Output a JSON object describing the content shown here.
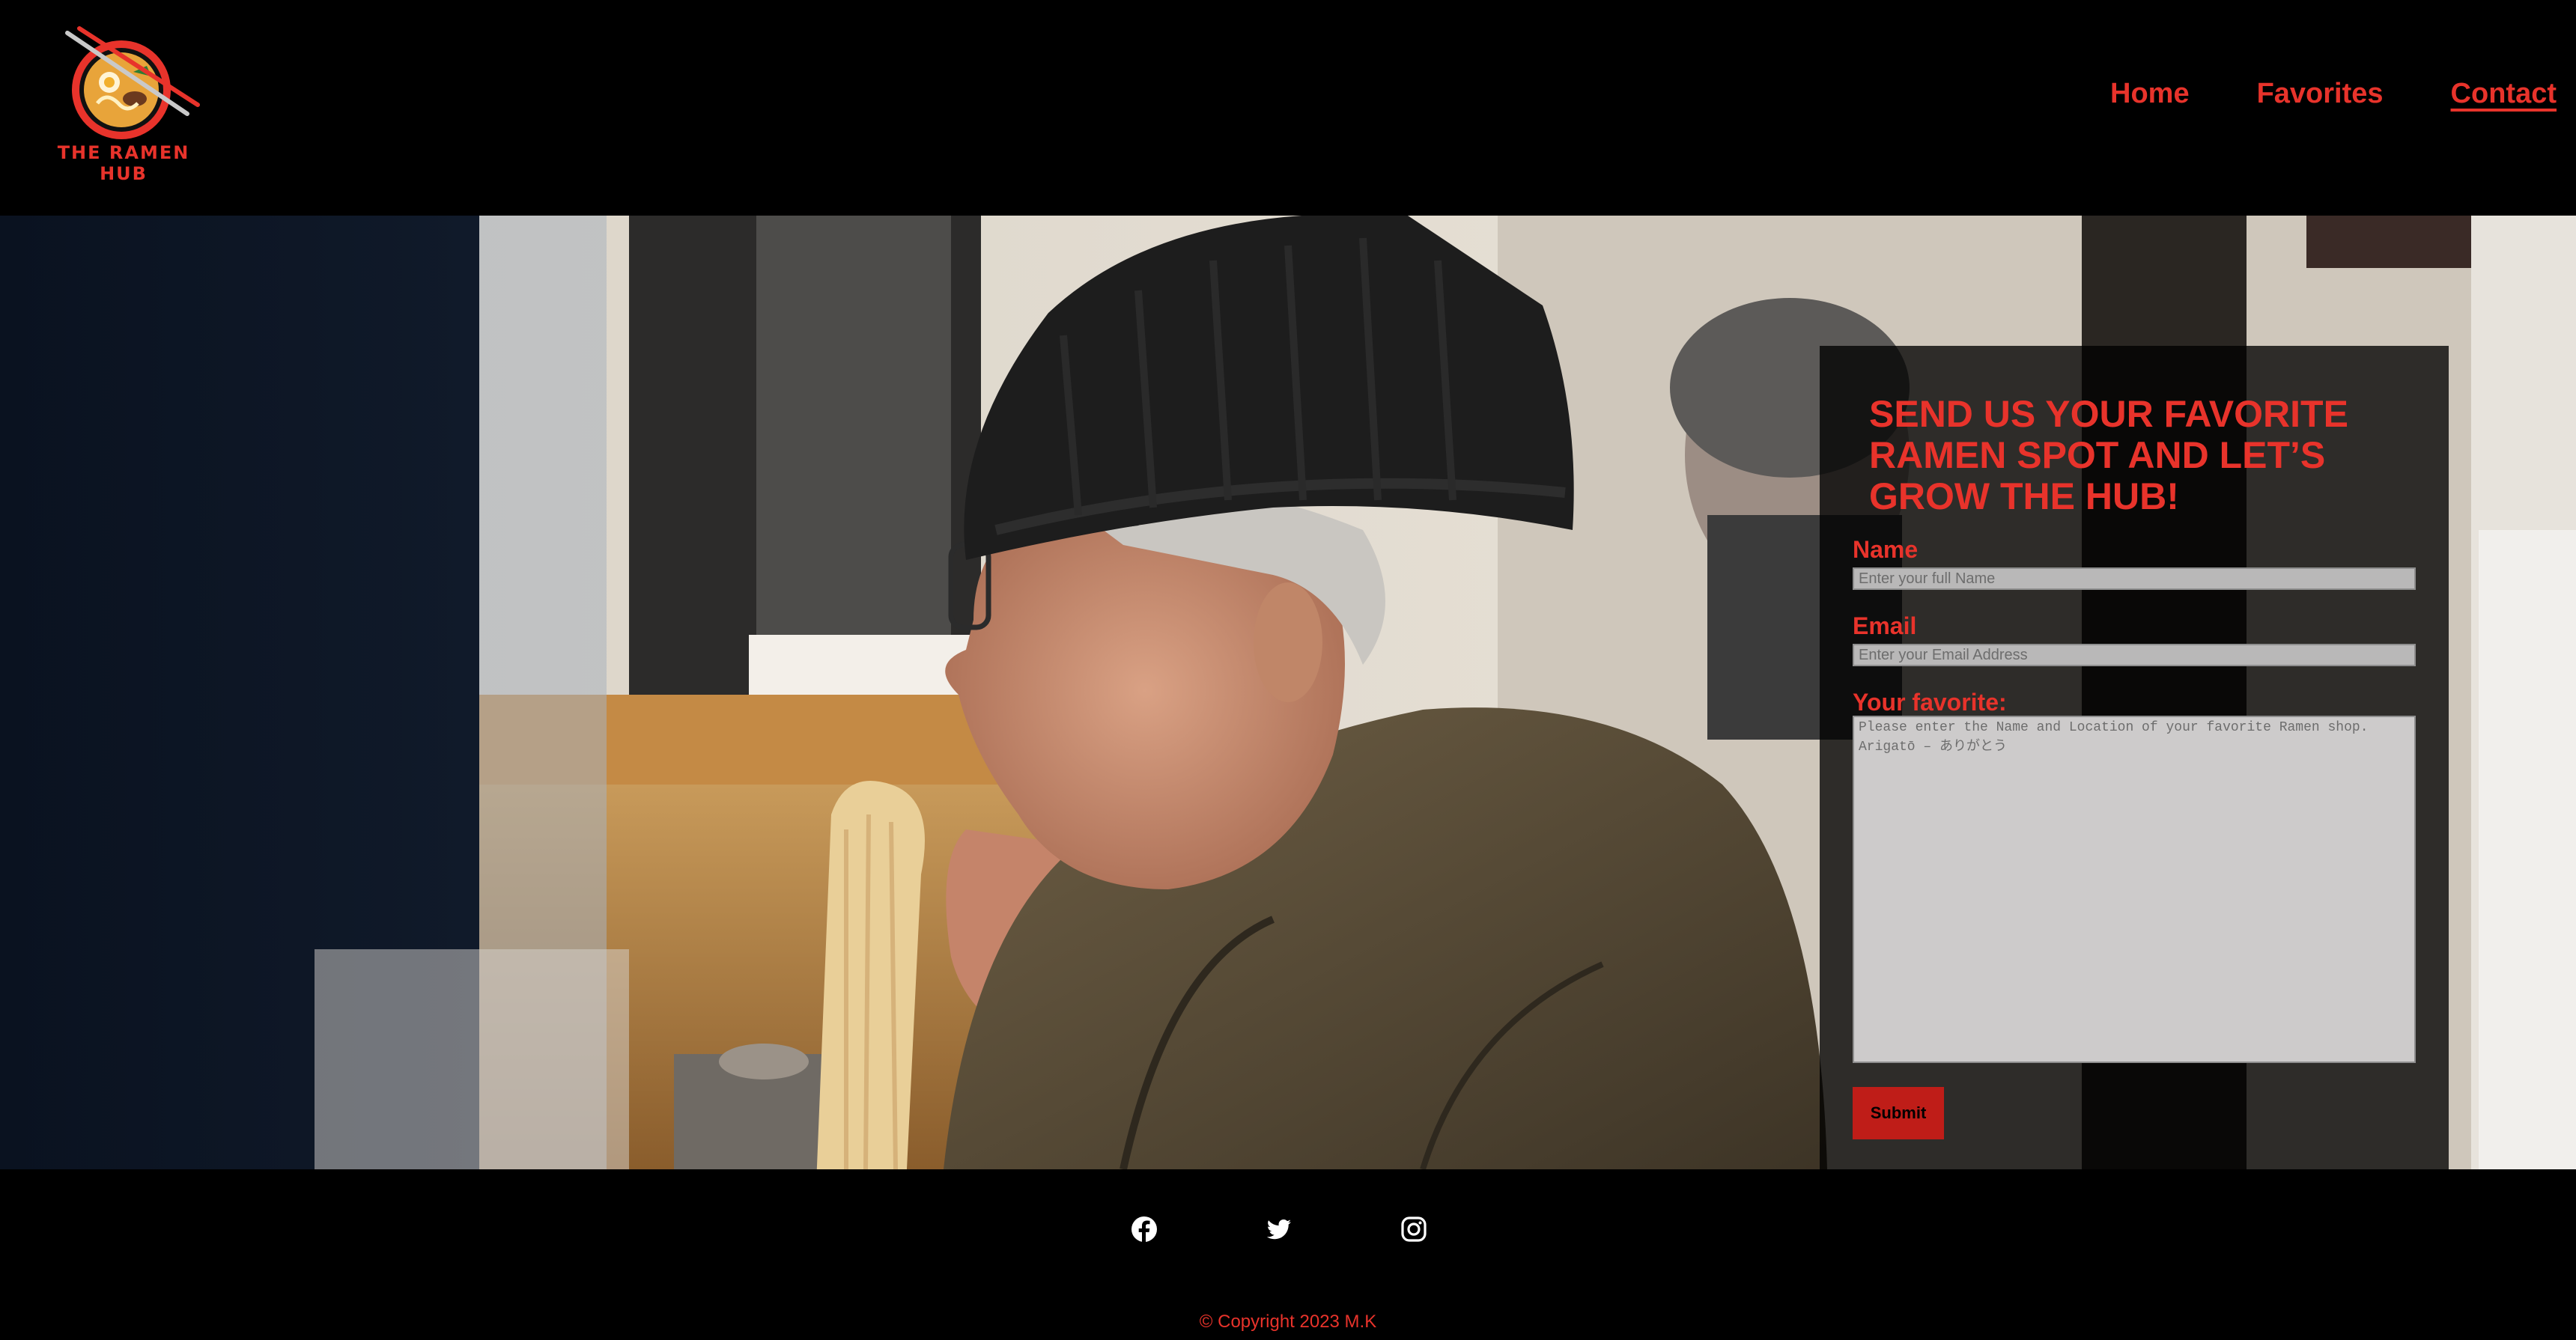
{
  "brand": {
    "name": "THE RAMEN HUB",
    "colors": {
      "accent": "#e8332b",
      "background": "#000000",
      "button": "#bf1d18"
    }
  },
  "nav": {
    "items": [
      {
        "label": "Home",
        "active": false
      },
      {
        "label": "Favorites",
        "active": false
      },
      {
        "label": "Contact",
        "active": true
      }
    ]
  },
  "hero": {
    "image_subject": "man-eating-ramen-photo"
  },
  "form": {
    "title": "SEND US YOUR FAVORITE RAMEN SPOT AND LET’S GROW THE HUB!",
    "name_label": "Name",
    "name_placeholder": "Enter your full Name",
    "email_label": "Email",
    "email_placeholder": "Enter your Email Address",
    "favorite_label": "Your favorite:",
    "favorite_placeholder": "Please enter the Name and Location of your favorite Ramen shop. Arigatō – ありがとう",
    "submit_label": "Submit"
  },
  "footer": {
    "social_icons": [
      "facebook-icon",
      "twitter-icon",
      "instagram-icon"
    ],
    "copyright": "© Copyright 2023 M.K"
  }
}
